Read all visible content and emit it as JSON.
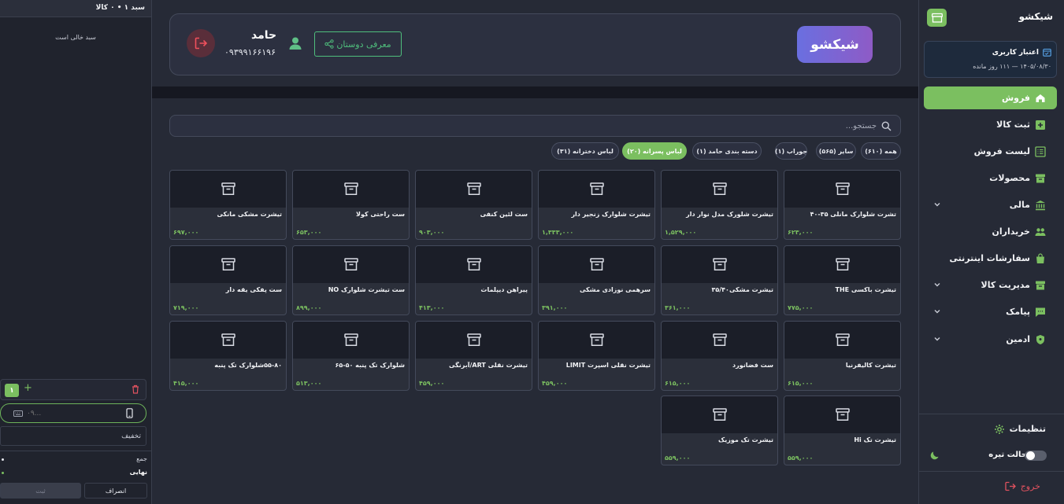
{
  "cart": {
    "title": "سبد ۱ • ۰ کالا",
    "empty_text": "سبد خالی است",
    "quantity": "۱",
    "phone_placeholder": "۰۹...",
    "discount_placeholder": "تخفیف",
    "sum_label": "جمع",
    "final_label": "نهایی",
    "cancel_label": "انصراف",
    "submit_label": "ثبت"
  },
  "header": {
    "brand": "شیکشو",
    "invite_label": "معرفی دوستان",
    "user_name": "حامد",
    "user_phone": "۰۹۳۹۹۱۶۶۱۹۶"
  },
  "search": {
    "placeholder": "جستجو..."
  },
  "categories": [
    {
      "label": "همه (۶۱۰)",
      "active": false
    },
    {
      "label": "سایر (۵۶۵)",
      "active": false
    },
    {
      "label": "جوراب (۱)",
      "active": false
    },
    {
      "label": "دسته بندی حامد (۱)",
      "active": false
    },
    {
      "label": "لباس پسرانه (۲۰)",
      "active": true
    },
    {
      "label": "لباس دخترانه (۳۱)",
      "active": false
    }
  ],
  "products": [
    {
      "name": "تشرت شلوارک مانلی ۳۵-۴۰",
      "price": "۶۲۳,۰۰۰"
    },
    {
      "name": "تیشرت شلورک مدل نوار دار",
      "price": "۱,۵۲۹,۰۰۰"
    },
    {
      "name": "تیشرت شلوارک زنجیر دار",
      "price": "۱,۳۳۳,۰۰۰"
    },
    {
      "name": "ست لئین کنفی",
      "price": "۹۰۳,۰۰۰"
    },
    {
      "name": "ست راحتی کولا",
      "price": "۶۵۳,۰۰۰"
    },
    {
      "name": "تیشرت مشکی مانکی",
      "price": "۶۹۷,۰۰۰"
    },
    {
      "name": "تیشرت باکسی THE",
      "price": "۷۷۵,۰۰۰"
    },
    {
      "name": "تیشرت مشکی۳۵/۴۰",
      "price": "۳۶۱,۰۰۰"
    },
    {
      "name": "سرهمی نوزادی مشکی",
      "price": "۳۹۱,۰۰۰"
    },
    {
      "name": "پیراهن دیپلمات",
      "price": "۴۱۳,۰۰۰"
    },
    {
      "name": "ست تیشرت شلوارک NO",
      "price": "۸۹۹,۰۰۰"
    },
    {
      "name": "ست پفکی یقه دار",
      "price": "۷۱۹,۰۰۰"
    },
    {
      "name": "تیشرت کالیفرنیا",
      "price": "۶۱۵,۰۰۰"
    },
    {
      "name": "ست فضانورد",
      "price": "۶۱۵,۰۰۰"
    },
    {
      "name": "تیشرت نقلی اسپرت LIMIT",
      "price": "۴۵۹,۰۰۰"
    },
    {
      "name": "تیشرت نقلی ART/آبرنگی",
      "price": "۴۵۹,۰۰۰"
    },
    {
      "name": "شلوارک تک پنبه ۵۰-۶۵",
      "price": "۵۱۳,۰۰۰"
    },
    {
      "name": "۵۵-۸۰شلوارک تک پنبه",
      "price": "۴۱۵,۰۰۰"
    },
    {
      "name": "تیشرت تک Hi",
      "price": "۵۵۹,۰۰۰"
    },
    {
      "name": "تیشرت تک موزیک",
      "price": "۵۵۹,۰۰۰"
    }
  ],
  "sidebar": {
    "title": "شیکشو",
    "credit_title": "اعتبار کاربری",
    "credit_sub": "۱۴۰۵/۰۸/۳۰ — ۱۱۱ روز مانده",
    "items": [
      {
        "label": "فروش",
        "icon": "home-icon",
        "active": true,
        "chevron": false
      },
      {
        "label": "ثبت کالا",
        "icon": "plus-box-icon",
        "active": false,
        "chevron": false
      },
      {
        "label": "لیست فروش",
        "icon": "list-icon",
        "active": false,
        "chevron": false
      },
      {
        "label": "محصولات",
        "icon": "archive-icon",
        "active": false,
        "chevron": false
      },
      {
        "label": "مالی",
        "icon": "bank-icon",
        "active": false,
        "chevron": true
      },
      {
        "label": "خریداران",
        "icon": "users-icon",
        "active": false,
        "chevron": false
      },
      {
        "label": "سفارشات اینترنتی",
        "icon": "shopping-bag-icon",
        "active": false,
        "chevron": false
      },
      {
        "label": "مدیریت کالا",
        "icon": "archive-icon",
        "active": false,
        "chevron": true
      },
      {
        "label": "پیامک",
        "icon": "message-icon",
        "active": false,
        "chevron": true
      },
      {
        "label": "ادمین",
        "icon": "shield-icon",
        "active": false,
        "chevron": true
      }
    ],
    "settings_label": "تنظیمات",
    "dark_mode_label": "حالت تیره",
    "logout_label": "خروج"
  },
  "colors": {
    "accent": "#7bbf60",
    "brand_gradient_start": "#6a6fe0",
    "brand_gradient_end": "#8e5bc6",
    "invite": "#4fbe7c",
    "danger": "#e0525f"
  }
}
